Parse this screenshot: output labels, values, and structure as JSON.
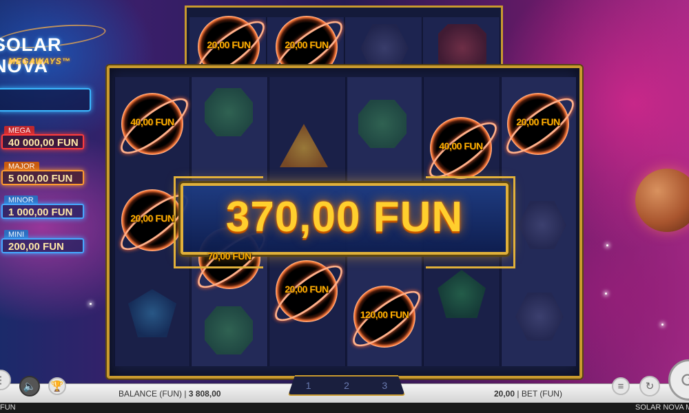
{
  "logo": {
    "title": "SOLAR NOVA",
    "subtitle": "MEGAWAYS™"
  },
  "jackpots": [
    {
      "tier": "MEGA",
      "value": "40 000,00 FUN"
    },
    {
      "tier": "MAJOR",
      "value": "5 000,00 FUN"
    },
    {
      "tier": "MINOR",
      "value": "1 000,00 FUN"
    },
    {
      "tier": "MINI",
      "value": "200,00 FUN"
    }
  ],
  "top_reel": [
    {
      "type": "coin",
      "label": "20,00 FUN"
    },
    {
      "type": "coin",
      "label": "20,00 FUN"
    },
    {
      "type": "gem",
      "gem": "hex"
    },
    {
      "type": "gem",
      "gem": "red"
    }
  ],
  "coins": {
    "c1": "40,00 FUN",
    "c2": "20,00 FUN",
    "c3": "70,00 FUN",
    "c4": "20,00 FUN",
    "c5": "120,00 FUN",
    "c6": "40,00 FUN",
    "c7": "20,00 FUN"
  },
  "win": {
    "amount": "370,00 FUN"
  },
  "pager": {
    "pages": [
      "1",
      "2",
      "3"
    ]
  },
  "bottom": {
    "balance_label": "BALANCE (FUN)",
    "balance_value": "3 808,00",
    "bet_value": "20,00",
    "bet_label": "BET",
    "bet_currency": "(FUN)"
  },
  "status": {
    "left": "FUN",
    "right": "SOLAR NOVA MEG"
  },
  "icons": {
    "mute": "speaker-mute-icon",
    "trophy": "trophy-icon",
    "coins": "coin-stack-icon",
    "autoplay": "autoplay-icon",
    "menu": "menu-icon",
    "spin": "spin-icon"
  }
}
